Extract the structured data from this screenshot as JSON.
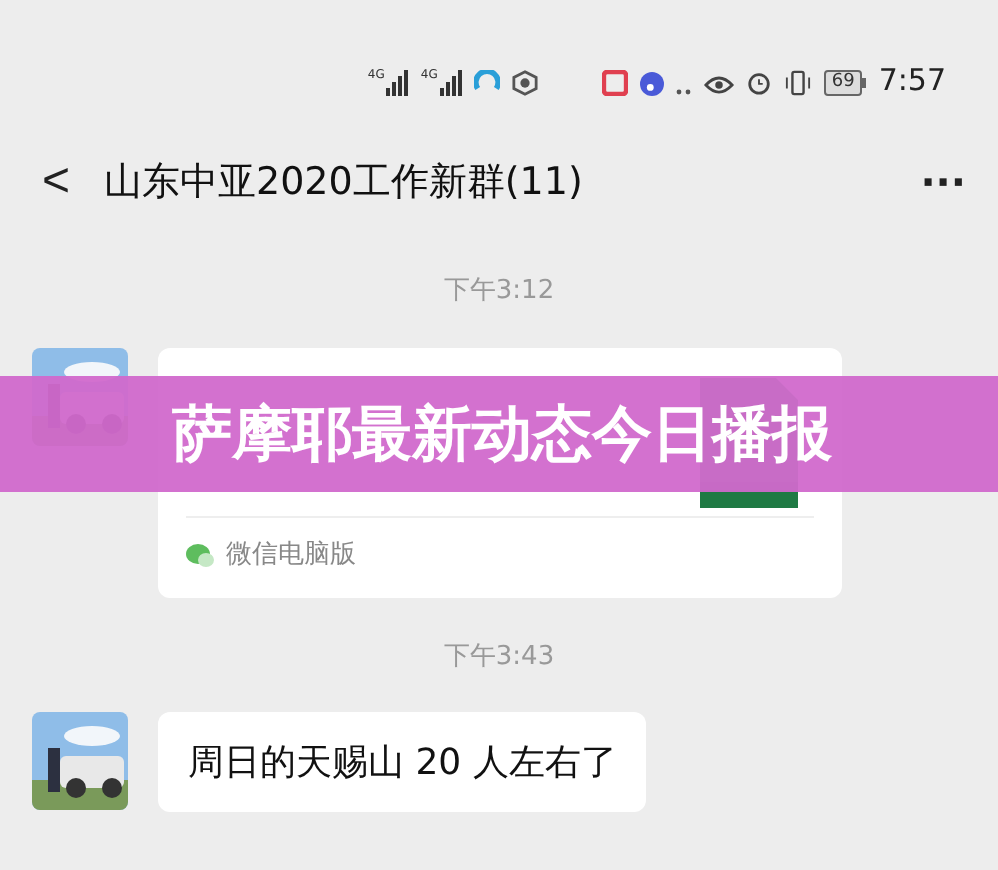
{
  "status_bar": {
    "time": "7:57",
    "battery": "69",
    "network_labels": [
      "4G",
      "4G"
    ]
  },
  "header": {
    "back": "<",
    "title": "山东中亚2020工作新群(11)",
    "more": "···"
  },
  "messages": [
    {
      "kind": "time",
      "text": "下午3:12"
    },
    {
      "kind": "file",
      "source": "微信电脑版"
    },
    {
      "kind": "time",
      "text": "下午3:43"
    },
    {
      "kind": "text",
      "text": "周日的天赐山 20 人左右了"
    }
  ],
  "banner": {
    "text": "萨摩耶最新动态今日播报"
  }
}
